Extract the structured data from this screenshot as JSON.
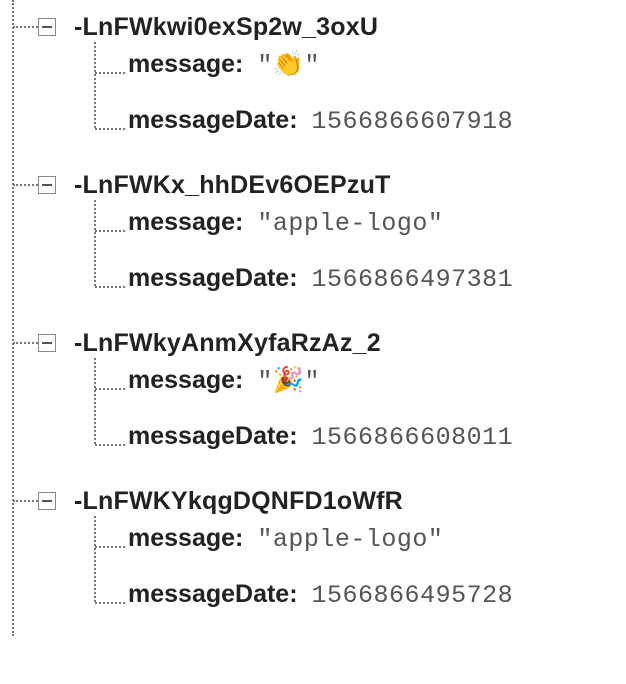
{
  "labels": {
    "messageKey": "message",
    "messageDateKey": "messageDate"
  },
  "nodes": [
    {
      "id": "-LnFWkwi0exSp2w_3oxU",
      "message": "👏",
      "messageDate": 1566866607918
    },
    {
      "id": "-LnFWKx_hhDEv6OEPzuT",
      "message": "apple-logo",
      "messageDate": 1566866497381
    },
    {
      "id": "-LnFWkyAnmXyfaRzAz_2",
      "message": "🎉",
      "messageDate": 1566866608011
    },
    {
      "id": "-LnFWKYkqgDQNFD1oWfR",
      "message": "apple-logo",
      "messageDate": 1566866495728
    }
  ]
}
